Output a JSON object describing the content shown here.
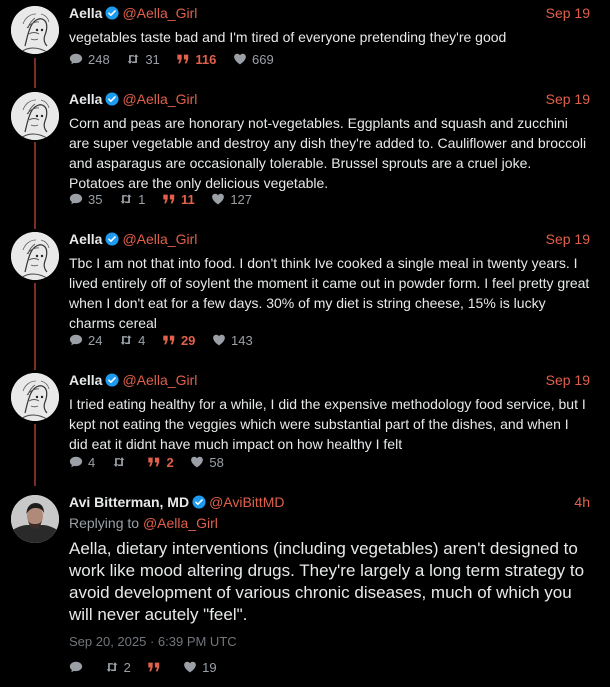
{
  "tweets": [
    {
      "name": "Aella",
      "handle": "@Aella_Girl",
      "date": "Sep 19",
      "text": "vegetables taste bad and I'm tired of everyone pretending they're good",
      "replies": "248",
      "retweets": "31",
      "quotes": "116",
      "likes": "669"
    },
    {
      "name": "Aella",
      "handle": "@Aella_Girl",
      "date": "Sep 19",
      "text": "Corn and peas are honorary not-vegetables. Eggplants and squash and zucchini are super vegetable and destroy any dish they're added to. Cauliflower and broccoli and asparagus are occasionally tolerable. Brussel sprouts are a cruel joke. Potatoes are the only delicious vegetable.",
      "replies": "35",
      "retweets": "1",
      "quotes": "11",
      "likes": "127"
    },
    {
      "name": "Aella",
      "handle": "@Aella_Girl",
      "date": "Sep 19",
      "text": "Tbc I am not that into food. I don't think Ive cooked a single meal in twenty years. I lived entirely off of soylent the moment it came out in powder form. I feel pretty great when I don't eat for a few days. 30% of my diet is string cheese, 15% is lucky charms cereal",
      "replies": "24",
      "retweets": "4",
      "quotes": "29",
      "likes": "143"
    },
    {
      "name": "Aella",
      "handle": "@Aella_Girl",
      "date": "Sep 19",
      "text": "I tried eating healthy for a while, I did the expensive methodology food service, but I kept not eating the veggies which were substantial part of the dishes, and when I did eat it didnt have much impact on how healthy I felt",
      "replies": "4",
      "retweets": "",
      "quotes": "2",
      "likes": "58"
    }
  ],
  "main_tweet": {
    "name": "Avi Bitterman, MD",
    "handle": "@AviBittMD",
    "date": "4h",
    "replying_label": "Replying to",
    "replying_handle": "@Aella_Girl",
    "text": "Aella, dietary interventions (including vegetables) aren't designed to work like mood altering drugs. They're largely a long term strategy to avoid development of various chronic diseases, much of which you will never acutely \"feel\".",
    "timestamp": "Sep 20, 2025 · 6:39 PM UTC",
    "replies": "",
    "retweets": "2",
    "quotes": "",
    "likes": "19"
  },
  "colors": {
    "accent": "#e0604b",
    "verified": "#1d9bf0",
    "thread_line": "#7a2e22",
    "muted": "#9aa0a6"
  },
  "icons": [
    "comment-icon",
    "retweet-icon",
    "quote-icon",
    "heart-icon",
    "verified-badge-icon"
  ]
}
